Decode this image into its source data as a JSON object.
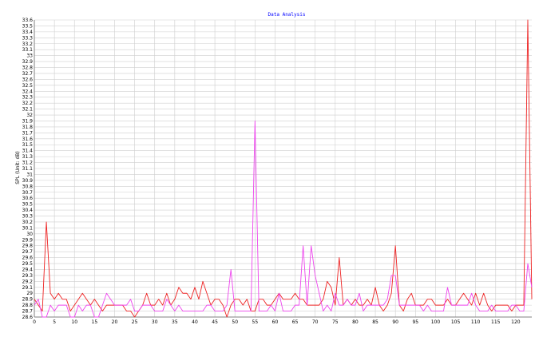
{
  "colors": {
    "title": "#0000ff",
    "grid": "#cfcfcf",
    "axis": "#808080",
    "background": "#ffffff"
  },
  "chart_data": {
    "type": "line",
    "title": "Data Analysis",
    "ylabel": "SPL  (Unit: dB)",
    "xlabel": "",
    "xlim": [
      0,
      124
    ],
    "ylim": [
      28.6,
      33.6
    ],
    "x_ticks": [
      0,
      5,
      10,
      15,
      20,
      25,
      30,
      35,
      40,
      45,
      50,
      55,
      60,
      65,
      70,
      75,
      80,
      85,
      90,
      95,
      100,
      105,
      110,
      115,
      120
    ],
    "y_ticks": [
      28.6,
      28.7,
      28.8,
      28.9,
      29,
      29.1,
      29.2,
      29.3,
      29.4,
      29.5,
      29.6,
      29.7,
      29.8,
      29.9,
      30,
      30.1,
      30.2,
      30.3,
      30.4,
      30.5,
      30.6,
      30.7,
      30.8,
      30.9,
      31,
      31.1,
      31.2,
      31.3,
      31.4,
      31.5,
      31.6,
      31.7,
      31.8,
      31.9,
      32,
      32.1,
      32.2,
      32.3,
      32.4,
      32.5,
      32.6,
      32.7,
      32.8,
      32.9,
      33,
      33.1,
      33.2,
      33.3,
      33.4,
      33.5,
      33.6
    ],
    "grid": true,
    "series": [
      {
        "color": "#ee2222",
        "x": [
          0,
          1,
          2,
          3,
          4,
          5,
          6,
          7,
          8,
          9,
          10,
          11,
          12,
          13,
          14,
          15,
          16,
          17,
          18,
          19,
          20,
          21,
          22,
          23,
          24,
          25,
          26,
          27,
          28,
          29,
          30,
          31,
          32,
          33,
          34,
          35,
          36,
          37,
          38,
          39,
          40,
          41,
          42,
          43,
          44,
          45,
          46,
          47,
          48,
          49,
          50,
          51,
          52,
          53,
          54,
          55,
          56,
          57,
          58,
          59,
          60,
          61,
          62,
          63,
          64,
          65,
          66,
          67,
          68,
          69,
          70,
          71,
          72,
          73,
          74,
          75,
          76,
          77,
          78,
          79,
          80,
          81,
          82,
          83,
          84,
          85,
          86,
          87,
          88,
          89,
          90,
          91,
          92,
          93,
          94,
          95,
          96,
          97,
          98,
          99,
          100,
          101,
          102,
          103,
          104,
          105,
          106,
          107,
          108,
          109,
          110,
          111,
          112,
          113,
          114,
          115,
          116,
          117,
          118,
          119,
          120,
          121,
          122,
          123,
          124
        ],
        "y": [
          28.9,
          28.8,
          28.7,
          30.2,
          29,
          28.9,
          29,
          28.9,
          28.9,
          28.7,
          28.8,
          28.9,
          29,
          28.9,
          28.8,
          28.9,
          28.8,
          28.7,
          28.8,
          28.8,
          28.8,
          28.8,
          28.8,
          28.7,
          28.7,
          28.6,
          28.7,
          28.8,
          29,
          28.8,
          28.8,
          28.9,
          28.8,
          29,
          28.8,
          28.9,
          29.1,
          29,
          29,
          28.9,
          29.1,
          28.9,
          29.2,
          29,
          28.8,
          28.9,
          28.9,
          28.8,
          28.6,
          28.8,
          28.9,
          28.9,
          28.8,
          28.9,
          28.7,
          28.7,
          28.9,
          28.9,
          28.8,
          28.8,
          28.9,
          29,
          28.9,
          28.9,
          28.9,
          29,
          28.9,
          28.9,
          28.8,
          28.8,
          28.8,
          28.8,
          28.9,
          29.2,
          29.1,
          28.8,
          29.6,
          28.8,
          28.9,
          28.8,
          28.9,
          28.8,
          28.8,
          28.9,
          28.8,
          29.1,
          28.8,
          28.7,
          28.8,
          29,
          29.8,
          28.8,
          28.7,
          28.9,
          29,
          28.8,
          28.8,
          28.8,
          28.9,
          28.9,
          28.8,
          28.8,
          28.8,
          28.9,
          28.8,
          28.8,
          28.9,
          29,
          28.9,
          28.8,
          29,
          28.8,
          29,
          28.8,
          28.7,
          28.8,
          28.8,
          28.8,
          28.8,
          28.7,
          28.8,
          28.8,
          28.8,
          33.6,
          28.9
        ]
      },
      {
        "color": "#ee44ee",
        "x": [
          0,
          1,
          2,
          3,
          4,
          5,
          6,
          7,
          8,
          9,
          10,
          11,
          12,
          13,
          14,
          15,
          16,
          17,
          18,
          19,
          20,
          21,
          22,
          23,
          24,
          25,
          26,
          27,
          28,
          29,
          30,
          31,
          32,
          33,
          34,
          35,
          36,
          37,
          38,
          39,
          40,
          41,
          42,
          43,
          44,
          45,
          46,
          47,
          48,
          49,
          50,
          51,
          52,
          53,
          54,
          55,
          56,
          57,
          58,
          59,
          60,
          61,
          62,
          63,
          64,
          65,
          66,
          67,
          68,
          69,
          70,
          71,
          72,
          73,
          74,
          75,
          76,
          77,
          78,
          79,
          80,
          81,
          82,
          83,
          84,
          85,
          86,
          87,
          88,
          89,
          90,
          91,
          92,
          93,
          94,
          95,
          96,
          97,
          98,
          99,
          100,
          101,
          102,
          103,
          104,
          105,
          106,
          107,
          108,
          109,
          110,
          111,
          112,
          113,
          114,
          115,
          116,
          117,
          118,
          119,
          120,
          121,
          122,
          123,
          124
        ],
        "y": [
          28.8,
          28.9,
          28.6,
          28.6,
          28.8,
          28.7,
          28.8,
          28.8,
          28.8,
          28.6,
          28.6,
          28.8,
          28.7,
          28.8,
          28.8,
          28.6,
          28.6,
          28.8,
          29,
          28.9,
          28.8,
          28.8,
          28.8,
          28.8,
          28.9,
          28.7,
          28.7,
          28.8,
          28.8,
          28.8,
          28.7,
          28.7,
          28.7,
          28.9,
          28.8,
          28.7,
          28.8,
          28.7,
          28.7,
          28.7,
          28.7,
          28.7,
          28.7,
          28.8,
          28.8,
          28.7,
          28.7,
          28.7,
          28.8,
          29.4,
          28.7,
          28.7,
          28.7,
          28.7,
          28.7,
          31.9,
          28.7,
          28.7,
          28.7,
          28.8,
          28.7,
          29,
          28.7,
          28.7,
          28.7,
          28.8,
          28.8,
          29.8,
          28.8,
          29.8,
          29.3,
          29,
          28.7,
          28.8,
          28.7,
          29,
          28.8,
          28.8,
          28.9,
          28.8,
          28.8,
          29,
          28.7,
          28.8,
          28.8,
          28.8,
          28.8,
          28.8,
          28.9,
          29.3,
          29.3,
          28.8,
          28.8,
          28.8,
          28.8,
          28.8,
          28.8,
          28.7,
          28.8,
          28.7,
          28.7,
          28.7,
          28.7,
          29.1,
          28.8,
          28.8,
          28.8,
          28.8,
          28.8,
          29,
          28.8,
          28.7,
          28.7,
          28.7,
          28.8,
          28.7,
          28.7,
          28.7,
          28.7,
          28.8,
          28.8,
          28.7,
          28.7,
          29.5,
          29.1
        ]
      }
    ]
  }
}
